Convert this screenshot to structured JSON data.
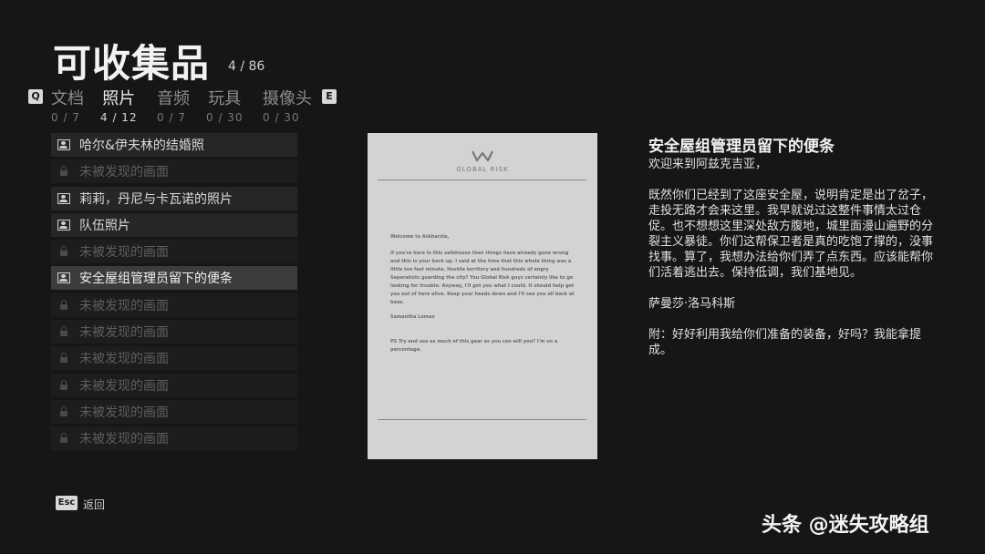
{
  "header": {
    "title": "可收集品",
    "count": "4 / 86"
  },
  "keys": {
    "prev": "Q",
    "next": "E"
  },
  "tabs": [
    {
      "label": "文档",
      "count": "0 / 7"
    },
    {
      "label": "照片",
      "count": "4 / 12",
      "active": true
    },
    {
      "label": "音频",
      "count": "0 / 7"
    },
    {
      "label": "玩具",
      "count": "0 / 30"
    },
    {
      "label": "摄像头",
      "count": "0 / 30"
    }
  ],
  "list": [
    {
      "label": "哈尔&伊夫林的结婚照",
      "state": "found"
    },
    {
      "label": "未被发现的画面",
      "state": "locked"
    },
    {
      "label": "莉莉，丹尼与卡瓦诺的照片",
      "state": "found"
    },
    {
      "label": "队伍照片",
      "state": "found"
    },
    {
      "label": "未被发现的画面",
      "state": "locked"
    },
    {
      "label": "安全屋组管理员留下的便条",
      "state": "selected"
    },
    {
      "label": "未被发现的画面",
      "state": "locked"
    },
    {
      "label": "未被发现的画面",
      "state": "locked"
    },
    {
      "label": "未被发现的画面",
      "state": "locked"
    },
    {
      "label": "未被发现的画面",
      "state": "locked"
    },
    {
      "label": "未被发现的画面",
      "state": "locked"
    },
    {
      "label": "未被发现的画面",
      "state": "locked"
    }
  ],
  "note": {
    "logo": "GLOBAL RISK",
    "greeting": "Welcome to Askharzia,",
    "body": "If you're here in this safehouse then things have already gone wrong and this is your back up. I said at the time that this whole thing was a little too fast minute. Hostile territory and hundreds of angry Separatists guarding the city? You Global Risk guys certainly like to go looking for trouble. Anyway, I'll got you what I could. It should help get you out of here alive. Keep your heads down and I'll see you all back at base.",
    "signature": "Samantha Lomax",
    "ps": "PS Try and use as much of this gear as you can will you? I'm on a percentage."
  },
  "detail": {
    "title": "安全屋组管理员留下的便条",
    "greeting": "欢迎来到阿兹克吉亚，",
    "body": "既然你们已经到了这座安全屋，说明肯定是出了岔子，走投无路才会来这里。我早就说过这整件事情太过仓促。也不想想这里深处敌方腹地，城里面漫山遍野的分裂主义暴徒。你们这帮保卫者是真的吃饱了撑的，没事找事。算了，我想办法给你们弄了点东西。应该能帮你们活着逃出去。保持低调，我们基地见。",
    "signature": "萨曼莎·洛马科斯",
    "ps": "附：好好利用我给你们准备的装备，好吗？我能拿提成。"
  },
  "footer": {
    "esc_key": "Esc",
    "back_label": "返回"
  },
  "watermark": "头条 @迷失攻略组"
}
